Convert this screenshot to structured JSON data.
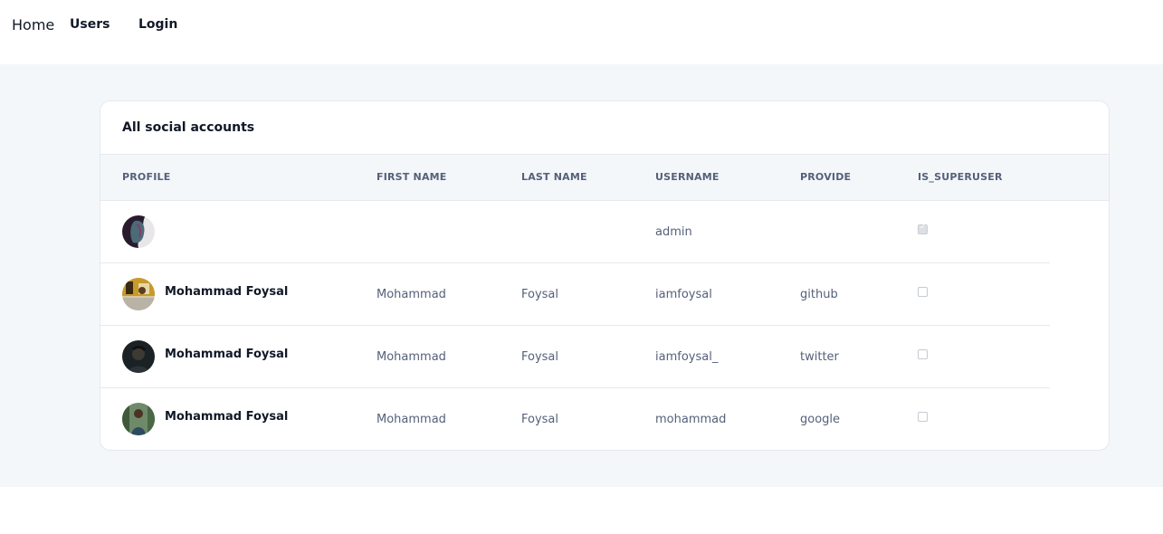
{
  "nav": {
    "home": "Home",
    "users": "Users",
    "login": "Login"
  },
  "card": {
    "title": "All social accounts"
  },
  "columns": [
    "PROFILE",
    "FIRST NAME",
    "LAST NAME",
    "USERNAME",
    "PROVIDE",
    "IS_SUPERUSER"
  ],
  "rows": [
    {
      "name": "",
      "first_name": "",
      "last_name": "",
      "username": "admin",
      "provider": "",
      "is_superuser": true
    },
    {
      "name": "Mohammad Foysal",
      "first_name": "Mohammad",
      "last_name": "Foysal",
      "username": "iamfoysal",
      "provider": "github",
      "is_superuser": false
    },
    {
      "name": "Mohammad Foysal",
      "first_name": "Mohammad",
      "last_name": "Foysal",
      "username": "iamfoysal_",
      "provider": "twitter",
      "is_superuser": false
    },
    {
      "name": "Mohammad Foysal",
      "first_name": "Mohammad",
      "last_name": "Foysal",
      "username": "mohammad",
      "provider": "google",
      "is_superuser": false
    }
  ]
}
